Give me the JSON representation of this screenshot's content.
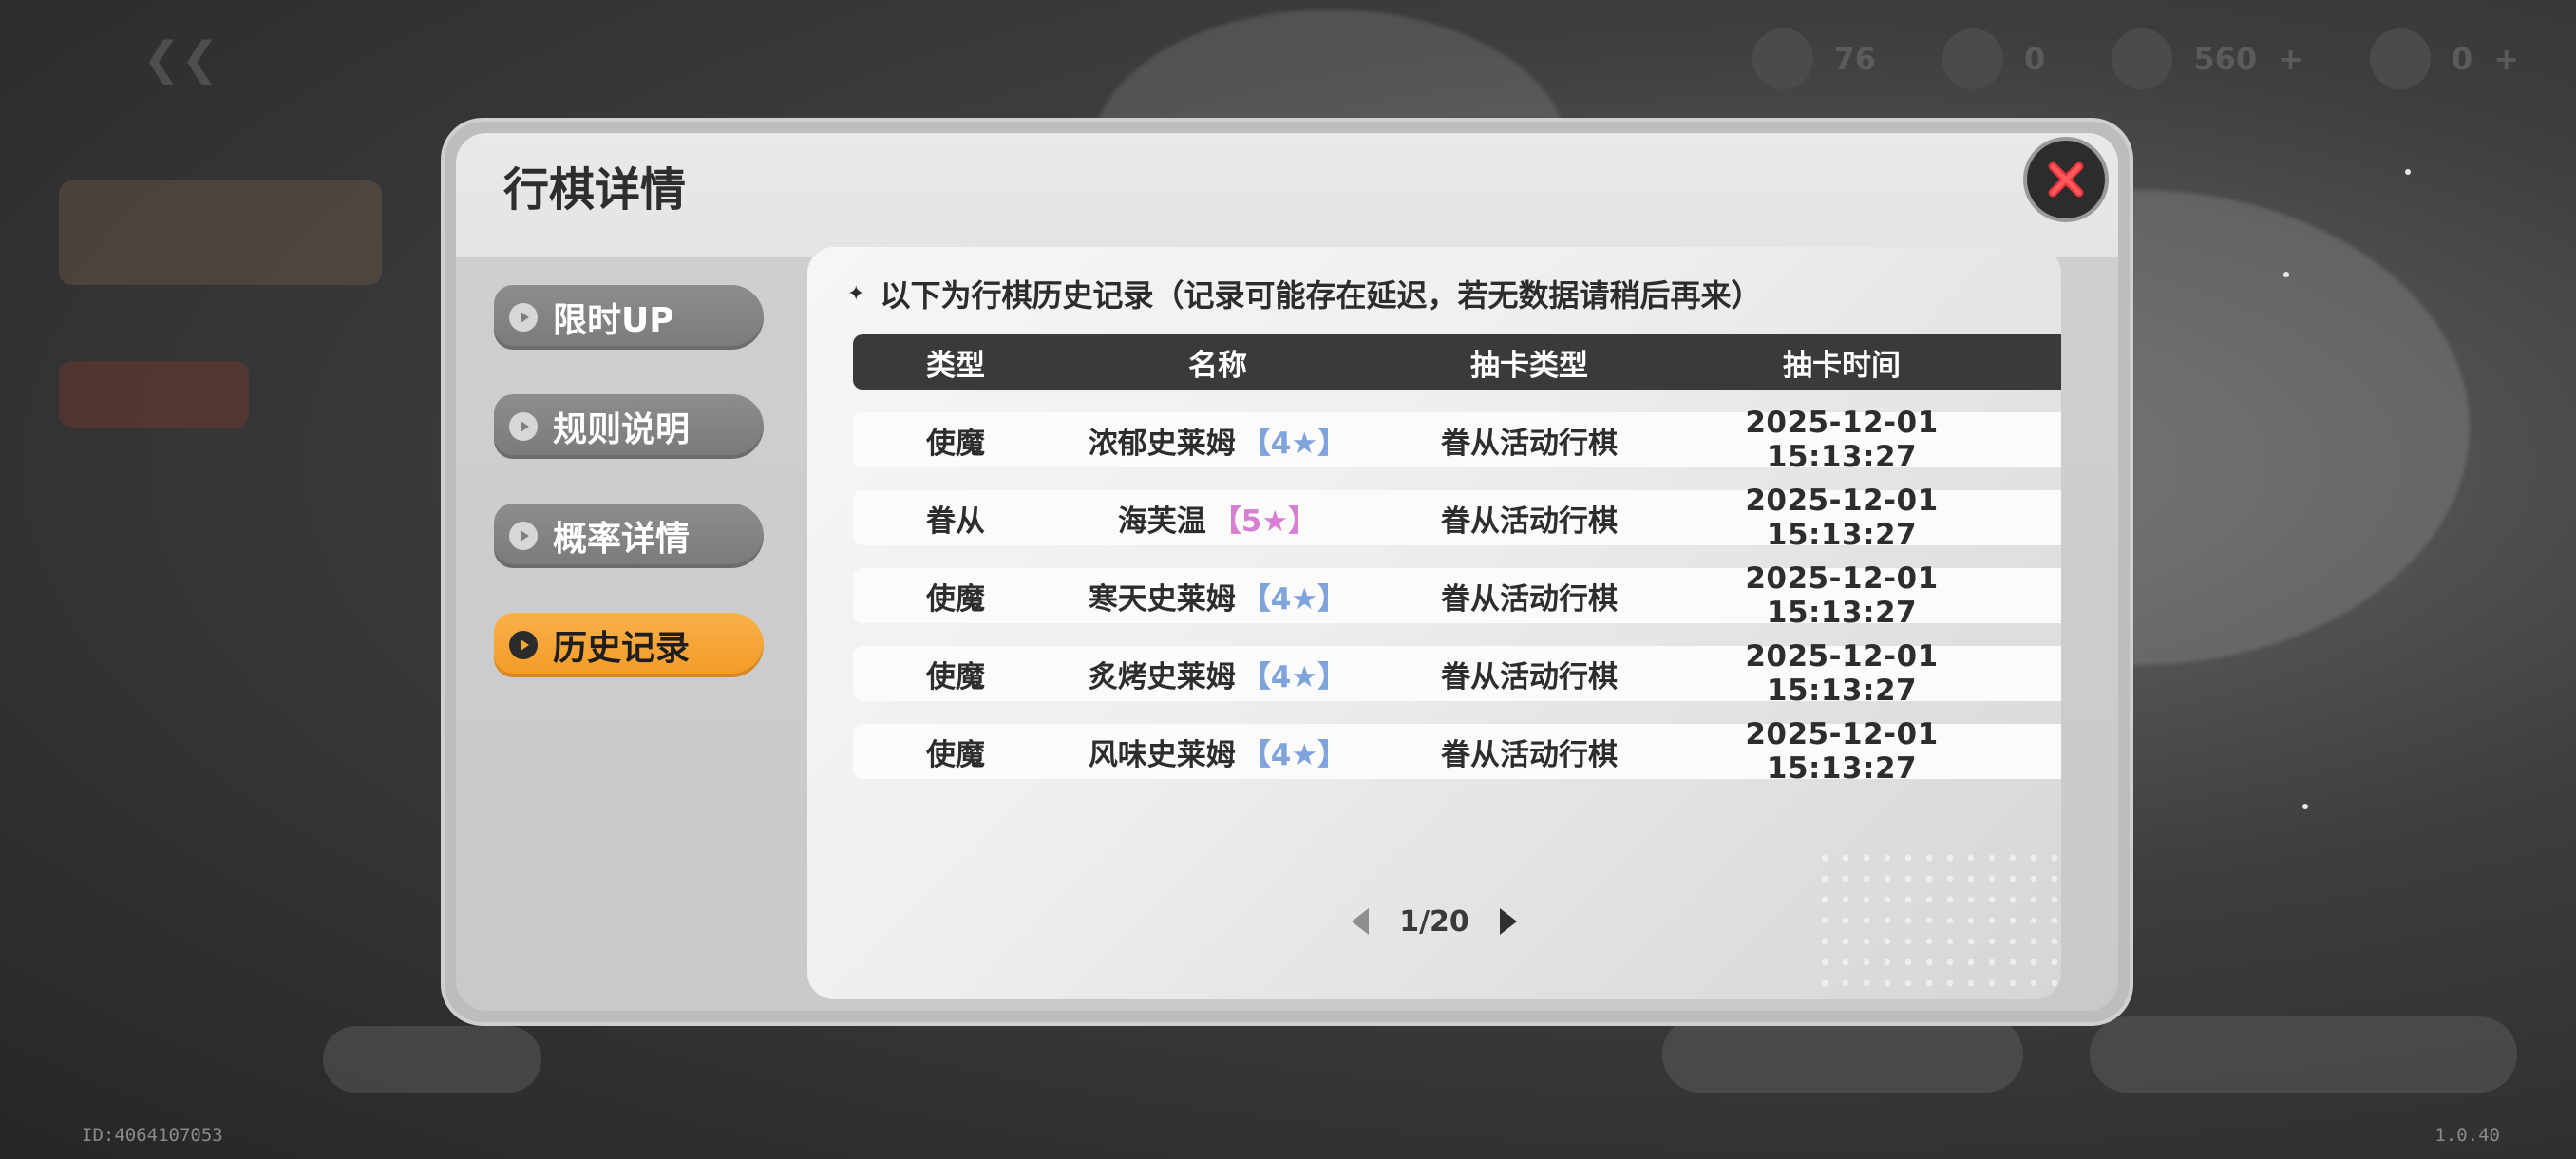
{
  "background": {
    "resources": [
      {
        "icon": "coin-icon",
        "value": "76"
      },
      {
        "icon": "character-icon",
        "value": "0"
      },
      {
        "icon": "crystal-icon",
        "value": "560"
      },
      {
        "icon": "crown-icon",
        "value": "0"
      }
    ],
    "footer_id": "ID:4064107053",
    "version": "1.0.40"
  },
  "modal": {
    "title": "行棋详情",
    "close_icon": "close-icon",
    "nav": [
      {
        "label": "限时UP",
        "active": false
      },
      {
        "label": "规则说明",
        "active": false
      },
      {
        "label": "概率详情",
        "active": false
      },
      {
        "label": "历史记录",
        "active": true
      }
    ],
    "notice": "以下为行棋历史记录（记录可能存在延迟，若无数据请稍后再来）",
    "table": {
      "headers": [
        "类型",
        "名称",
        "抽卡类型",
        "抽卡时间"
      ],
      "rows": [
        {
          "type": "使魔",
          "name": "浓郁史莱姆",
          "rarity": "【4★】",
          "rarity_level": 4,
          "gacha": "眷从活动行棋",
          "time": "2025-12-01 15:13:27"
        },
        {
          "type": "眷从",
          "name": "海芙温",
          "rarity": "【5★】",
          "rarity_level": 5,
          "gacha": "眷从活动行棋",
          "time": "2025-12-01 15:13:27"
        },
        {
          "type": "使魔",
          "name": "寒天史莱姆",
          "rarity": "【4★】",
          "rarity_level": 4,
          "gacha": "眷从活动行棋",
          "time": "2025-12-01 15:13:27"
        },
        {
          "type": "使魔",
          "name": "炙烤史莱姆",
          "rarity": "【4★】",
          "rarity_level": 4,
          "gacha": "眷从活动行棋",
          "time": "2025-12-01 15:13:27"
        },
        {
          "type": "使魔",
          "name": "风味史莱姆",
          "rarity": "【4★】",
          "rarity_level": 4,
          "gacha": "眷从活动行棋",
          "time": "2025-12-01 15:13:27"
        }
      ]
    },
    "pagination": {
      "current": 1,
      "total": 20,
      "label": "1/20"
    }
  },
  "colors": {
    "accent_orange": "#f6a834",
    "rarity4": "#7fa4db",
    "rarity5": "#d77fd2",
    "header_dark": "#3a3a3a"
  }
}
